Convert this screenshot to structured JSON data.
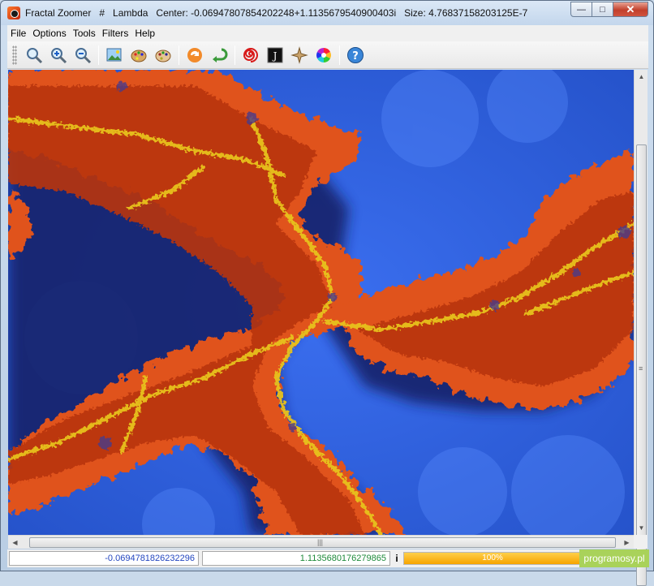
{
  "titlebar": {
    "app_name": "Fractal Zoomer",
    "hash": "#",
    "fractal_type": "Lambda",
    "center_text": "Center: -0.06947807854202248+1.1135679540900403i",
    "size_text": "Size: 4.76837158203125E-7",
    "minimize_glyph": "—",
    "maximize_glyph": "□",
    "close_glyph": "✕"
  },
  "menu": [
    "File",
    "Options",
    "Tools",
    "Filters",
    "Help"
  ],
  "toolbar": {
    "icons": [
      {
        "name": "zoom-icon",
        "glyph": "🔍"
      },
      {
        "name": "zoom-in-icon",
        "glyph": "⊕"
      },
      {
        "name": "zoom-out-icon",
        "glyph": "⊖"
      },
      {
        "name": "save-image-icon",
        "glyph": "🖼"
      },
      {
        "name": "palette-icon",
        "glyph": "🎨"
      },
      {
        "name": "palette-out-icon",
        "glyph": "🎨"
      },
      {
        "name": "refresh-icon",
        "glyph": "⟳"
      },
      {
        "name": "go-to-icon",
        "glyph": "↶"
      },
      {
        "name": "spiral-icon",
        "glyph": "◎"
      },
      {
        "name": "julia-icon",
        "glyph": "J"
      },
      {
        "name": "polar-icon",
        "glyph": "✶"
      },
      {
        "name": "color-wheel-icon",
        "glyph": "●"
      },
      {
        "name": "help-icon",
        "glyph": "?"
      }
    ]
  },
  "status": {
    "real": "-0.0694781826232296",
    "imaginary": "1.1135680176279865",
    "imag_unit": "i",
    "progress_label": "100%",
    "progress_value": 1.0
  },
  "watermark": "programosy.pl",
  "colors": {
    "fractal_blue": "#2f5fe0",
    "fractal_orange": "#e0531a",
    "fractal_yellow": "#e8c21c",
    "close_red": "#c2402c",
    "progress_orange": "#f6a400"
  }
}
